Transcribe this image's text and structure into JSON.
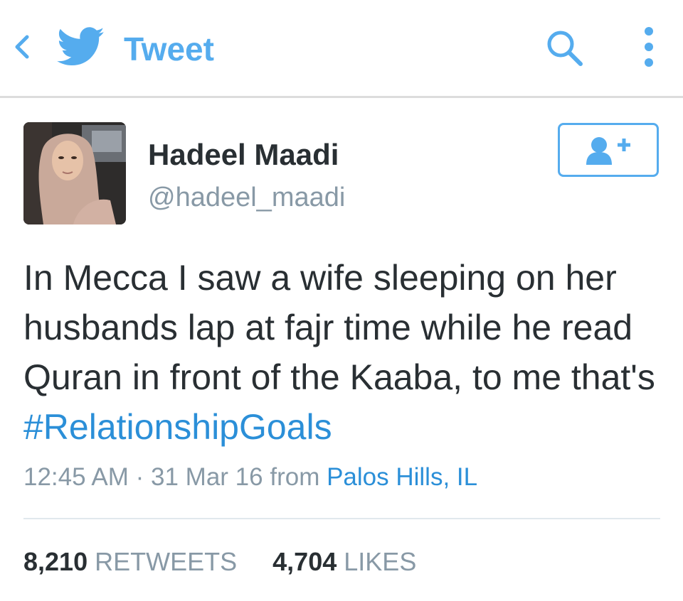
{
  "header": {
    "title": "Tweet",
    "back_icon": "chevron-left-icon",
    "logo_icon": "twitter-bird-icon",
    "search_icon": "search-icon",
    "more_icon": "more-vertical-icon",
    "accent_color": "#55acee"
  },
  "user": {
    "name": "Hadeel Maadi",
    "handle": "@hadeel_maadi",
    "follow_icon": "add-user-icon"
  },
  "tweet": {
    "text": "In Mecca I saw a wife sleeping on her husbands lap at fajr time while he read Quran in front of the Kaaba, to me that's ",
    "hashtag": "#RelationshipGoals",
    "time": "12:45 AM",
    "separator": "·",
    "date": "31 Mar 16",
    "from_label": "from",
    "location": "Palos Hills, IL",
    "link_color": "#2b8fd8"
  },
  "stats": {
    "retweets_count": "8,210",
    "retweets_label": "RETWEETS",
    "likes_count": "4,704",
    "likes_label": "LIKES"
  }
}
